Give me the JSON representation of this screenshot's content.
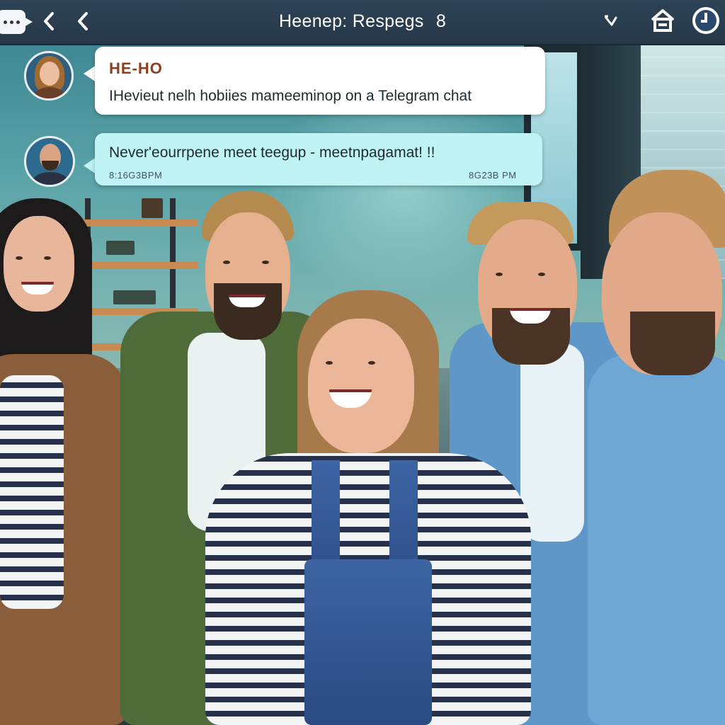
{
  "header": {
    "title": "Heenep: Respegs",
    "count": "8"
  },
  "messages": [
    {
      "sender": "HE-HO",
      "text": "IHevieut nelh hobiies mameeminop on a Telegram chat",
      "time_left": "",
      "time_right": ""
    },
    {
      "sender": "",
      "text": "Never'eourrpene meet teegup - meetnpagamat! !!",
      "time_left": "8:16G3BPM",
      "time_right": "8G23B PM"
    }
  ],
  "colors": {
    "topbar": "#263849",
    "bubble_1": "#ffffff",
    "bubble_2": "#bff3f4",
    "sender_name": "#8e3f1f"
  },
  "icons": [
    "chat-logo-icon",
    "back-chevron-icon",
    "back-chevron-icon",
    "dropdown-chevron-icon",
    "home-icon",
    "clock-icon"
  ]
}
